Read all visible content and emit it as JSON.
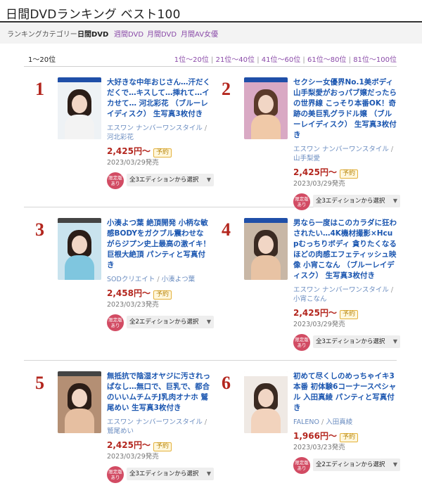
{
  "page_title": "日間DVDランキング ベスト100",
  "categories": {
    "label": "ランキングカテゴリー",
    "current": "日間DVD",
    "links": [
      "週間DVD",
      "月間DVD",
      "月間AV女優"
    ]
  },
  "pagination": {
    "range_label": "1〜20位",
    "pages": [
      "1位〜20位",
      "21位〜40位",
      "41位〜60位",
      "61位〜80位",
      "81位〜100位"
    ],
    "separator": "|"
  },
  "items": [
    {
      "rank": "1",
      "title": "大好きな中年おじさん…汗だくだくで…キスして…挿れて…イカせて… 河北彩花 （ブルーレイディスク） 生写真3枚付き",
      "maker": "エスワン ナンバーワンスタイル",
      "sep": "/",
      "actress": "河北彩花",
      "price": "2,425円〜",
      "reserve": "予約",
      "date": "2023/03/29発売",
      "badge": "限定版あり",
      "edition": "全3エディションから選択",
      "band": "#1f4fa8",
      "photo": "#eef2f5",
      "body": "#f3f3f3",
      "hair": "#2b1d17"
    },
    {
      "rank": "2",
      "title": "セクシー女優界No.1美ボディ 山手梨愛がおっパブ嬢だったらの世界線 こっそり本番OK！奇跡の美巨乳グラドル嬢 （ブルーレイディスク） 生写真3枚付き",
      "maker": "エスワン ナンバーワンスタイル",
      "sep": "/",
      "actress": "山手梨愛",
      "price": "2,425円〜",
      "reserve": "予約",
      "date": "2023/03/29発売",
      "badge": "限定版あり",
      "edition": "全3エディションから選択",
      "band": "#1f4fa8",
      "photo": "#d9a9c4",
      "body": "#f0c9a8",
      "hair": "#5a3a2a"
    },
    {
      "rank": "3",
      "title": "小湊よつ葉 絶頂開発 小柄な敏感BODYをガクブル震わせながらジプン史上最高の激イキ！巨根大絶頂 パンティと写真付き",
      "maker": "SODクリエイト",
      "sep": "/",
      "actress": "小湊よつ葉",
      "price": "2,458円〜",
      "reserve": "予約",
      "date": "2023/03/23発売",
      "badge": "限定版あり",
      "edition": "全2エディションから選択",
      "band": "#444444",
      "photo": "#c9e3ee",
      "body": "#7fc6df",
      "hair": "#2b1d17"
    },
    {
      "rank": "4",
      "title": "男なら一度はこのカラダに狂わされたい…4K機材撮影×Hcupむっちりボディ 貪りたくなるほどの肉感エフェティッシュ映像 小宵こなん （ブルーレイディスク） 生写真3枚付き",
      "maker": "エスワン ナンバーワンスタイル",
      "sep": "/",
      "actress": "小宵こなん",
      "price": "2,425円〜",
      "reserve": "予約",
      "date": "2023/03/29発売",
      "badge": "限定版あり",
      "edition": "全3エディションから選択",
      "band": "#1f4fa8",
      "photo": "#c8b7a6",
      "body": "#e8c3a4",
      "hair": "#3a2a22"
    },
    {
      "rank": "5",
      "title": "無抵抗で陰湿オヤジに汚されっぱなし…無口で、巨乳で、都合のいいムチムチJ乳肉オナホ 鷲尾めい 生写真3枚付き",
      "maker": "エスワン ナンバーワンスタイル",
      "sep": "/",
      "actress": "鷲尾めい",
      "price": "2,425円〜",
      "reserve": "予約",
      "date": "2023/03/29発売",
      "badge": "限定版あり",
      "edition": "全3エディションから選択",
      "band": "#444444",
      "photo": "#b48f74",
      "body": "#e6bfa1",
      "hair": "#2b1d17"
    },
    {
      "rank": "6",
      "title": "初めて尽くしのめっちゃイキ3本番 初体験6コーナースペシャル 入田真綾 パンティと写真付き",
      "maker": "FALENO",
      "sep": "/",
      "actress": "入田真綾",
      "price": "1,966円〜",
      "reserve": "予約",
      "date": "2023/03/23発売",
      "badge": "限定版あり",
      "edition": "全2エディションから選択",
      "band": "#ffffff",
      "photo": "#efe9e4",
      "body": "#f2d3bd",
      "hair": "#3a2a22"
    }
  ]
}
